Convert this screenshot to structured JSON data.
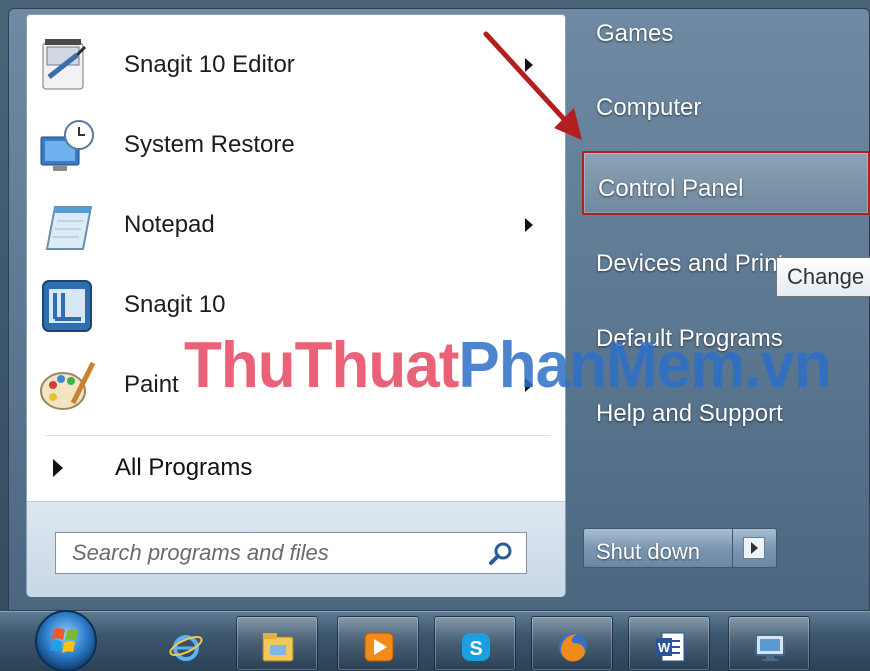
{
  "start_menu": {
    "programs": [
      {
        "label": "Snagit 10 Editor",
        "icon": "snagit-editor-icon",
        "has_submenu": true
      },
      {
        "label": "System Restore",
        "icon": "system-restore-icon",
        "has_submenu": false
      },
      {
        "label": "Notepad",
        "icon": "notepad-icon",
        "has_submenu": true
      },
      {
        "label": "Snagit 10",
        "icon": "snagit-icon",
        "has_submenu": false
      },
      {
        "label": "Paint",
        "icon": "paint-icon",
        "has_submenu": true
      }
    ],
    "all_programs_label": "All Programs",
    "search": {
      "placeholder": "Search programs and files",
      "value": ""
    },
    "right_items": [
      {
        "label": "Games"
      },
      {
        "label": "Computer"
      },
      {
        "label": "Control Panel",
        "highlighted": true
      },
      {
        "label": "Devices and Printers"
      },
      {
        "label": "Default Programs"
      },
      {
        "label": "Help and Support"
      }
    ],
    "tooltip": "Change",
    "shutdown_label": "Shut down"
  },
  "watermark": {
    "part_a": "ThuThuat",
    "part_b": "PhanMem.vn"
  },
  "taskbar": {
    "buttons": [
      {
        "name": "internet-explorer"
      },
      {
        "name": "windows-explorer"
      },
      {
        "name": "media-player"
      },
      {
        "name": "skype"
      },
      {
        "name": "firefox"
      },
      {
        "name": "word"
      },
      {
        "name": "remote-desktop"
      }
    ]
  },
  "colors": {
    "highlight_border": "#b31e1e",
    "annotation_arrow": "#b31e1e",
    "watermark_a": "#e6465f",
    "watermark_b": "#2d6ec8"
  }
}
